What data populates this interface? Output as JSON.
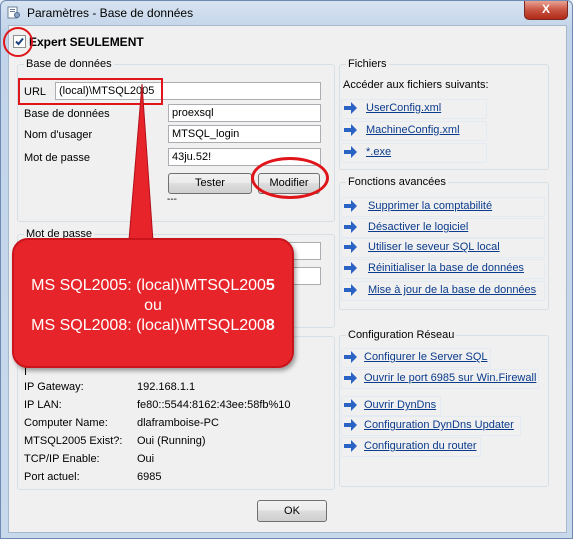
{
  "window": {
    "title": "Paramètres - Base de données",
    "close_label": "X"
  },
  "expert": {
    "label": "Expert SEULEMENT",
    "checked": true
  },
  "db_group": {
    "legend": "Base de données",
    "url_label": "URL",
    "url_value": "(local)\\MTSQL2005",
    "db_label": "Base de données",
    "db_value": "proexsql",
    "user_label": "Nom d'usager",
    "user_value": "MTSQL_login",
    "pass_label": "Mot de passe",
    "pass_value": "43ju.52!",
    "test_button": "Tester",
    "modify_button": "Modifier",
    "dashes": "---"
  },
  "pw_group": {
    "legend": "Mot de passe"
  },
  "callout": {
    "line1_prefix": "MS SQL2005: (local)\\MTSQL200",
    "line1_bold": "5",
    "line2": "ou",
    "line3_prefix": "MS SQL2008: (local)\\MTSQL200",
    "line3_bold": "8"
  },
  "info": {
    "partial_label": "I",
    "rows": [
      {
        "label": "IP Gateway:",
        "value": "192.168.1.1"
      },
      {
        "label": "IP LAN:",
        "value": "fe80::5544:8162:43ee:58fb%10"
      },
      {
        "label": "Computer Name:",
        "value": "dlaframboise-PC"
      },
      {
        "label": "MTSQL2005 Exist?:",
        "value": "Oui (Running)"
      },
      {
        "label": "TCP/IP Enable:",
        "value": "Oui"
      },
      {
        "label": "Port actuel:",
        "value": "6985"
      }
    ]
  },
  "files_group": {
    "legend": "Fichiers",
    "intro": "Accéder aux fichiers suivants:",
    "items": [
      "UserConfig.xml",
      "MachineConfig.xml",
      "*.exe"
    ]
  },
  "advanced_group": {
    "legend": "Fonctions avancées",
    "items": [
      "Supprimer la comptabilité",
      "Désactiver le logiciel",
      "Utiliser le seveur SQL local",
      "Réinitialiser la base de données",
      "Mise à jour de la base de données"
    ]
  },
  "network_group": {
    "legend": "Configuration Réseau",
    "items": [
      "Configurer le Server SQL",
      "Ouvrir le port 6985 sur Win.Firewall",
      "Ouvrir DynDns",
      "Configuration DynDns Updater",
      "Configuration du router"
    ]
  },
  "ok_button": "OK",
  "colors": {
    "annotation_red": "#e0151a",
    "callout_fill": "#e8242b",
    "link": "#0b3b8c"
  }
}
